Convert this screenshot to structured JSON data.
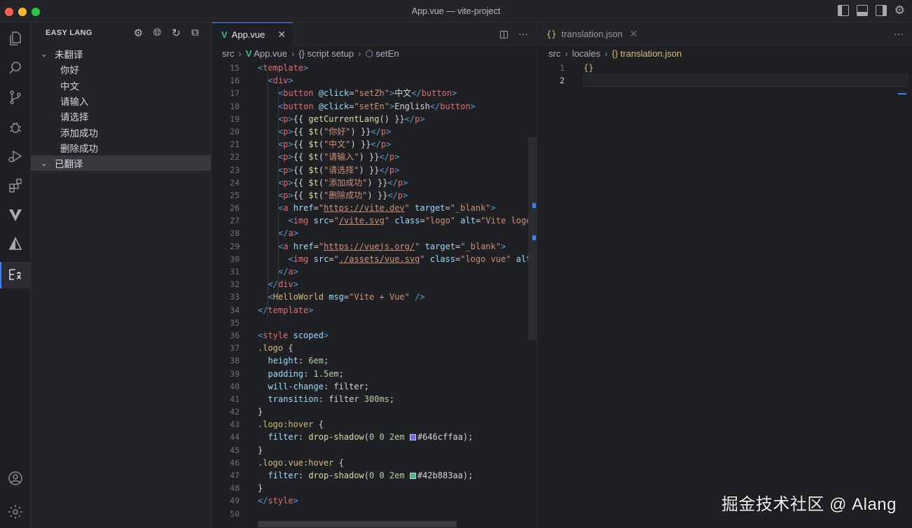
{
  "window": {
    "title": "App.vue — vite-project"
  },
  "activity_bar": [
    "explorer-icon",
    "search-icon",
    "source-control-icon",
    "debug-icon",
    "run-debug-icon",
    "extensions-icon",
    "vitest-icon",
    "deploy-icon",
    "easy-lang-icon",
    "account-icon",
    "manage-gear-icon"
  ],
  "sidebar": {
    "title": "EASY LANG",
    "groups": [
      {
        "label": "未翻译",
        "expanded": true,
        "items": [
          "你好",
          "中文",
          "请输入",
          "请选择",
          "添加成功",
          "删除成功"
        ]
      },
      {
        "label": "已翻译",
        "expanded": true,
        "items": []
      }
    ]
  },
  "editor_left": {
    "tab": {
      "label": "App.vue",
      "close": "✕"
    },
    "breadcrumb": [
      "src",
      "App.vue",
      "{} script setup",
      "setEn"
    ],
    "lines": [
      {
        "n": "15",
        "html": "<span class=\"tg\">&lt;</span><span class=\"tn\">template</span><span class=\"tg\">&gt;</span>",
        "indent": 0
      },
      {
        "n": "16",
        "html": "<span class=\"tg\">&lt;</span><span class=\"tn\">div</span><span class=\"tg\">&gt;</span>",
        "indent": 1
      },
      {
        "n": "17",
        "html": "<span class=\"tg\">&lt;</span><span class=\"tn\">button</span> <span class=\"at\">@click</span>=<span class=\"st\">\"setZh\"</span><span class=\"tg\">&gt;</span>中文<span class=\"tg\">&lt;/</span><span class=\"tn\">button</span><span class=\"tg\">&gt;</span>",
        "indent": 2
      },
      {
        "n": "18",
        "html": "<span class=\"tg\">&lt;</span><span class=\"tn\">button</span> <span class=\"at\">@click</span>=<span class=\"st\">\"setEn\"</span><span class=\"tg\">&gt;</span>English<span class=\"tg\">&lt;/</span><span class=\"tn\">button</span><span class=\"tg\">&gt;</span>",
        "indent": 2
      },
      {
        "n": "19",
        "html": "<span class=\"tg\">&lt;</span><span class=\"tn\">p</span><span class=\"tg\">&gt;</span>{{ <span class=\"fn\">getCurrentLang</span>() }}<span class=\"tg\">&lt;/</span><span class=\"tn\">p</span><span class=\"tg\">&gt;</span>",
        "indent": 2
      },
      {
        "n": "20",
        "html": "<span class=\"tg\">&lt;</span><span class=\"tn\">p</span><span class=\"tg\">&gt;</span>{{ <span class=\"fn\">$t</span>(<span class=\"st\">\"你好\"</span>) }}<span class=\"tg\">&lt;/</span><span class=\"tn\">p</span><span class=\"tg\">&gt;</span>",
        "indent": 2
      },
      {
        "n": "21",
        "html": "<span class=\"tg\">&lt;</span><span class=\"tn\">p</span><span class=\"tg\">&gt;</span>{{ <span class=\"fn\">$t</span>(<span class=\"st\">\"中文\"</span>) }}<span class=\"tg\">&lt;/</span><span class=\"tn\">p</span><span class=\"tg\">&gt;</span>",
        "indent": 2
      },
      {
        "n": "22",
        "html": "<span class=\"tg\">&lt;</span><span class=\"tn\">p</span><span class=\"tg\">&gt;</span>{{ <span class=\"fn\">$t</span>(<span class=\"st\">\"请输入\"</span>) }}<span class=\"tg\">&lt;/</span><span class=\"tn\">p</span><span class=\"tg\">&gt;</span>",
        "indent": 2
      },
      {
        "n": "23",
        "html": "<span class=\"tg\">&lt;</span><span class=\"tn\">p</span><span class=\"tg\">&gt;</span>{{ <span class=\"fn\">$t</span>(<span class=\"st\">\"请选择\"</span>) }}<span class=\"tg\">&lt;/</span><span class=\"tn\">p</span><span class=\"tg\">&gt;</span>",
        "indent": 2
      },
      {
        "n": "24",
        "html": "<span class=\"tg\">&lt;</span><span class=\"tn\">p</span><span class=\"tg\">&gt;</span>{{ <span class=\"fn\">$t</span>(<span class=\"st\">\"添加成功\"</span>) }}<span class=\"tg\">&lt;/</span><span class=\"tn\">p</span><span class=\"tg\">&gt;</span>",
        "indent": 2
      },
      {
        "n": "25",
        "html": "<span class=\"tg\">&lt;</span><span class=\"tn\">p</span><span class=\"tg\">&gt;</span>{{ <span class=\"fn\">$t</span>(<span class=\"st\">\"删除成功\"</span>) }}<span class=\"tg\">&lt;/</span><span class=\"tn\">p</span><span class=\"tg\">&gt;</span>",
        "indent": 2
      },
      {
        "n": "26",
        "html": "<span class=\"tg\">&lt;</span><span class=\"tn\">a</span> <span class=\"at\">href</span>=<span class=\"st\">\"<u>https://vite.dev</u>\"</span> <span class=\"at\">target</span>=<span class=\"st\">\"_blank\"</span><span class=\"tg\">&gt;</span>",
        "indent": 2
      },
      {
        "n": "27",
        "html": "<span class=\"tg\">&lt;</span><span class=\"tn\">img</span> <span class=\"at\">src</span>=<span class=\"st\">\"<u>/vite.svg</u>\"</span> <span class=\"at\">class</span>=<span class=\"st\">\"logo\"</span> <span class=\"at\">alt</span>=<span class=\"st\">\"Vite logo\"</span>",
        "indent": 3
      },
      {
        "n": "28",
        "html": "<span class=\"tg\">&lt;/</span><span class=\"tn\">a</span><span class=\"tg\">&gt;</span>",
        "indent": 2
      },
      {
        "n": "29",
        "html": "<span class=\"tg\">&lt;</span><span class=\"tn\">a</span> <span class=\"at\">href</span>=<span class=\"st\">\"<u>https://vuejs.org/</u>\"</span> <span class=\"at\">target</span>=<span class=\"st\">\"_blank\"</span><span class=\"tg\">&gt;</span>",
        "indent": 2
      },
      {
        "n": "30",
        "html": "<span class=\"tg\">&lt;</span><span class=\"tn\">img</span> <span class=\"at\">src</span>=<span class=\"st\">\"<u>./assets/vue.svg</u>\"</span> <span class=\"at\">class</span>=<span class=\"st\">\"logo vue\"</span> <span class=\"at\">alt</span>=",
        "indent": 3
      },
      {
        "n": "31",
        "html": "<span class=\"tg\">&lt;/</span><span class=\"tn\">a</span><span class=\"tg\">&gt;</span>",
        "indent": 2
      },
      {
        "n": "32",
        "html": "<span class=\"tg\">&lt;/</span><span class=\"tn\">div</span><span class=\"tg\">&gt;</span>",
        "indent": 1
      },
      {
        "n": "33",
        "html": "<span class=\"tg\">&lt;</span><span class=\"cls\">HelloWorld</span> <span class=\"at\">msg</span>=<span class=\"st\">\"Vite + Vue\"</span> <span class=\"tg\">/&gt;</span>",
        "indent": 1
      },
      {
        "n": "34",
        "html": "<span class=\"tg\">&lt;/</span><span class=\"tn\">template</span><span class=\"tg\">&gt;</span>",
        "indent": 0
      },
      {
        "n": "35",
        "html": "",
        "indent": 0
      },
      {
        "n": "36",
        "html": "<span class=\"tg\">&lt;</span><span class=\"tn\">style</span> <span class=\"at\">scoped</span><span class=\"tg\">&gt;</span>",
        "indent": 0
      },
      {
        "n": "37",
        "html": "<span class=\"cls\">.logo</span> {",
        "indent": 0
      },
      {
        "n": "38",
        "html": "<span class=\"pr\">height</span>: <span class=\"nm\">6em</span>;",
        "indent": 1
      },
      {
        "n": "39",
        "html": "<span class=\"pr\">padding</span>: <span class=\"nm\">1.5em</span>;",
        "indent": 1
      },
      {
        "n": "40",
        "html": "<span class=\"pr\">will-change</span>: filter;",
        "indent": 1
      },
      {
        "n": "41",
        "html": "<span class=\"pr\">transition</span>: filter <span class=\"nm\">300ms</span>;",
        "indent": 1
      },
      {
        "n": "42",
        "html": "}",
        "indent": 0
      },
      {
        "n": "43",
        "html": "<span class=\"cls\">.logo:hover</span> {",
        "indent": 0
      },
      {
        "n": "44",
        "html": "<span class=\"pr\">filter</span>: <span class=\"fn\">drop-shadow</span>(<span class=\"nm\">0 0 2em</span> <span class=\"sw\" style=\"background:#646cff\"></span>#646cffaa);",
        "indent": 1
      },
      {
        "n": "45",
        "html": "}",
        "indent": 0
      },
      {
        "n": "46",
        "html": "<span class=\"cls\">.logo.vue:hover</span> {",
        "indent": 0
      },
      {
        "n": "47",
        "html": "<span class=\"pr\">filter</span>: <span class=\"fn\">drop-shadow</span>(<span class=\"nm\">0 0 2em</span> <span class=\"sw\" style=\"background:#42b883\"></span>#42b883aa);",
        "indent": 1
      },
      {
        "n": "48",
        "html": "}",
        "indent": 0
      },
      {
        "n": "49",
        "html": "<span class=\"tg\">&lt;/</span><span class=\"tn\">style</span><span class=\"tg\">&gt;</span>",
        "indent": 0
      },
      {
        "n": "50",
        "html": "",
        "indent": 0
      }
    ]
  },
  "editor_right": {
    "tab": {
      "label": "translation.json",
      "close": "✕"
    },
    "breadcrumb": [
      "src",
      "locales",
      "{} translation.json"
    ],
    "lines": [
      {
        "n": "1",
        "text": "{}"
      },
      {
        "n": "2",
        "text": ""
      }
    ]
  },
  "watermark": "掘金技术社区 @ Alang",
  "colors": {
    "accent": "#3b82f6",
    "vue_green": "#42b883",
    "vite_purple": "#646cff"
  }
}
